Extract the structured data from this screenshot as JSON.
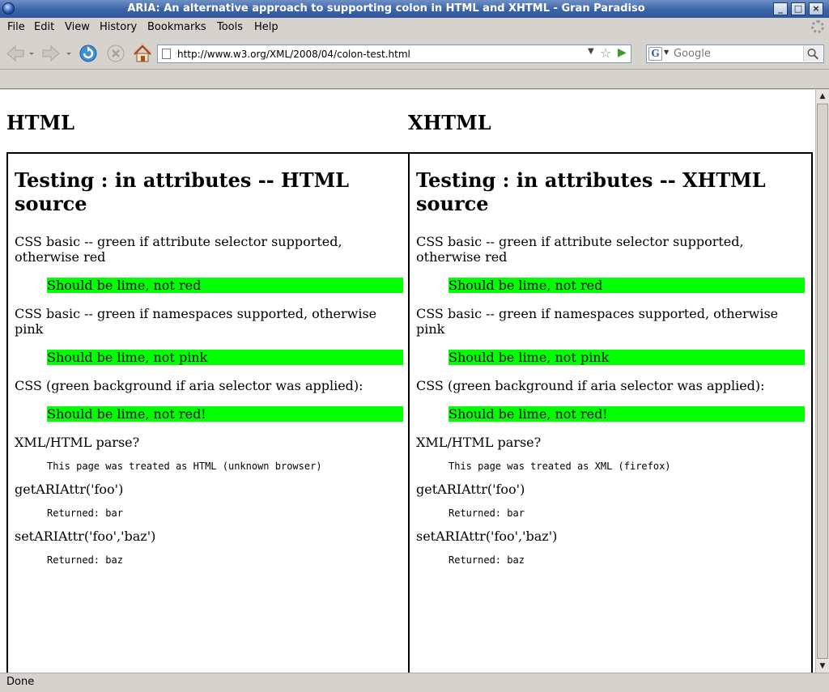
{
  "window": {
    "title": "ARIA: An alternative approach to supporting colon in HTML and XHTML - Gran Paradiso",
    "minimize_label": "_",
    "maximize_label": "□",
    "close_label": "×"
  },
  "menu": [
    {
      "label": "File"
    },
    {
      "label": "Edit"
    },
    {
      "label": "View"
    },
    {
      "label": "History"
    },
    {
      "label": "Bookmarks"
    },
    {
      "label": "Tools"
    },
    {
      "label": "Help"
    }
  ],
  "navigation": {
    "url": "http://www.w3.org/XML/2008/04/colon-test.html",
    "search_placeholder": "Google"
  },
  "status": "Done",
  "columns": {
    "left_label": "HTML",
    "right_label": "XHTML"
  },
  "panels": [
    {
      "heading": "Testing : in attributes -- HTML source",
      "css_attr_desc": "CSS basic -- green if attribute selector supported, otherwise red",
      "css_attr_result": "Should be lime, not red",
      "css_ns_desc": "CSS basic -- green if namespaces supported, otherwise pink",
      "css_ns_result": "Should be lime, not pink",
      "css_aria_desc": "CSS (green background if aria selector was applied):",
      "css_aria_result": "Should be lime, not red!",
      "parse_desc": "XML/HTML parse?",
      "parse_result": "This page was treated as HTML (unknown browser)",
      "get_desc": "getARIAttr('foo')",
      "get_result": "Returned: bar",
      "set_desc": "setARIAttr('foo','baz')",
      "set_result": "Returned: baz"
    },
    {
      "heading": "Testing : in attributes -- XHTML source",
      "css_attr_desc": "CSS basic -- green if attribute selector supported, otherwise red",
      "css_attr_result": "Should be lime, not red",
      "css_ns_desc": "CSS basic -- green if namespaces supported, otherwise pink",
      "css_ns_result": "Should be lime, not pink",
      "css_aria_desc": "CSS (green background if aria selector was applied):",
      "css_aria_result": "Should be lime, not red!",
      "parse_desc": "XML/HTML parse?",
      "parse_result": "This page was treated as XML (firefox)",
      "get_desc": "getARIAttr('foo')",
      "get_result": "Returned: bar",
      "set_desc": "setARIAttr('foo','baz')",
      "set_result": "Returned: baz"
    }
  ],
  "colors": {
    "pass": "#00ff00",
    "titlebar": "#3b63a8",
    "chrome": "#d6d3ce"
  }
}
